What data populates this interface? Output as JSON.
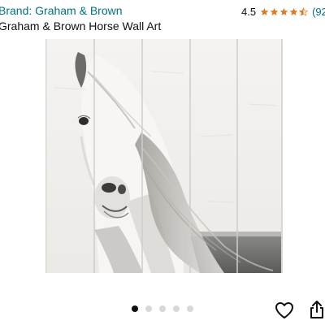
{
  "product": {
    "brand_link": "Brand: Graham & Brown",
    "title": "Graham & Brown Horse Wall Art",
    "rating": {
      "value": "4.5",
      "stars": 4.5,
      "review_count": "(92)"
    },
    "image_icon": "horse-on-wood-planks-image"
  },
  "gallery": {
    "total": 5,
    "active_index": 0
  },
  "actions": {
    "favorite_icon": "heart-icon",
    "share_icon": "share-icon"
  },
  "colors": {
    "link": "#007185",
    "star": "#de7921",
    "text": "#0f1111",
    "dot_active": "#0f1111",
    "dot_inactive": "#d5d9d9"
  }
}
